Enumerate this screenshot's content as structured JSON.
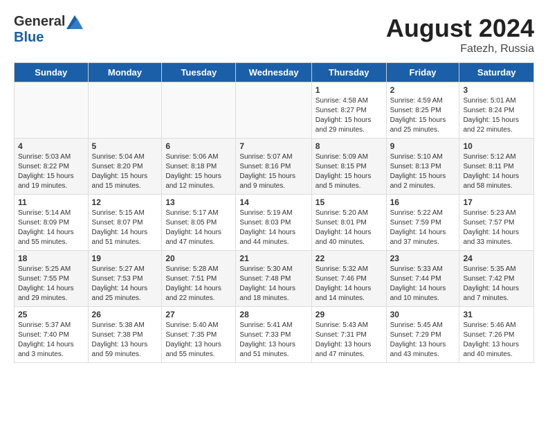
{
  "header": {
    "logo_general": "General",
    "logo_blue": "Blue",
    "month_year": "August 2024",
    "location": "Fatezh, Russia"
  },
  "weekdays": [
    "Sunday",
    "Monday",
    "Tuesday",
    "Wednesday",
    "Thursday",
    "Friday",
    "Saturday"
  ],
  "weeks": [
    [
      {
        "day": "",
        "info": ""
      },
      {
        "day": "",
        "info": ""
      },
      {
        "day": "",
        "info": ""
      },
      {
        "day": "",
        "info": ""
      },
      {
        "day": "1",
        "info": "Sunrise: 4:58 AM\nSunset: 8:27 PM\nDaylight: 15 hours\nand 29 minutes."
      },
      {
        "day": "2",
        "info": "Sunrise: 4:59 AM\nSunset: 8:25 PM\nDaylight: 15 hours\nand 25 minutes."
      },
      {
        "day": "3",
        "info": "Sunrise: 5:01 AM\nSunset: 8:24 PM\nDaylight: 15 hours\nand 22 minutes."
      }
    ],
    [
      {
        "day": "4",
        "info": "Sunrise: 5:03 AM\nSunset: 8:22 PM\nDaylight: 15 hours\nand 19 minutes."
      },
      {
        "day": "5",
        "info": "Sunrise: 5:04 AM\nSunset: 8:20 PM\nDaylight: 15 hours\nand 15 minutes."
      },
      {
        "day": "6",
        "info": "Sunrise: 5:06 AM\nSunset: 8:18 PM\nDaylight: 15 hours\nand 12 minutes."
      },
      {
        "day": "7",
        "info": "Sunrise: 5:07 AM\nSunset: 8:16 PM\nDaylight: 15 hours\nand 9 minutes."
      },
      {
        "day": "8",
        "info": "Sunrise: 5:09 AM\nSunset: 8:15 PM\nDaylight: 15 hours\nand 5 minutes."
      },
      {
        "day": "9",
        "info": "Sunrise: 5:10 AM\nSunset: 8:13 PM\nDaylight: 15 hours\nand 2 minutes."
      },
      {
        "day": "10",
        "info": "Sunrise: 5:12 AM\nSunset: 8:11 PM\nDaylight: 14 hours\nand 58 minutes."
      }
    ],
    [
      {
        "day": "11",
        "info": "Sunrise: 5:14 AM\nSunset: 8:09 PM\nDaylight: 14 hours\nand 55 minutes."
      },
      {
        "day": "12",
        "info": "Sunrise: 5:15 AM\nSunset: 8:07 PM\nDaylight: 14 hours\nand 51 minutes."
      },
      {
        "day": "13",
        "info": "Sunrise: 5:17 AM\nSunset: 8:05 PM\nDaylight: 14 hours\nand 47 minutes."
      },
      {
        "day": "14",
        "info": "Sunrise: 5:19 AM\nSunset: 8:03 PM\nDaylight: 14 hours\nand 44 minutes."
      },
      {
        "day": "15",
        "info": "Sunrise: 5:20 AM\nSunset: 8:01 PM\nDaylight: 14 hours\nand 40 minutes."
      },
      {
        "day": "16",
        "info": "Sunrise: 5:22 AM\nSunset: 7:59 PM\nDaylight: 14 hours\nand 37 minutes."
      },
      {
        "day": "17",
        "info": "Sunrise: 5:23 AM\nSunset: 7:57 PM\nDaylight: 14 hours\nand 33 minutes."
      }
    ],
    [
      {
        "day": "18",
        "info": "Sunrise: 5:25 AM\nSunset: 7:55 PM\nDaylight: 14 hours\nand 29 minutes."
      },
      {
        "day": "19",
        "info": "Sunrise: 5:27 AM\nSunset: 7:53 PM\nDaylight: 14 hours\nand 25 minutes."
      },
      {
        "day": "20",
        "info": "Sunrise: 5:28 AM\nSunset: 7:51 PM\nDaylight: 14 hours\nand 22 minutes."
      },
      {
        "day": "21",
        "info": "Sunrise: 5:30 AM\nSunset: 7:48 PM\nDaylight: 14 hours\nand 18 minutes."
      },
      {
        "day": "22",
        "info": "Sunrise: 5:32 AM\nSunset: 7:46 PM\nDaylight: 14 hours\nand 14 minutes."
      },
      {
        "day": "23",
        "info": "Sunrise: 5:33 AM\nSunset: 7:44 PM\nDaylight: 14 hours\nand 10 minutes."
      },
      {
        "day": "24",
        "info": "Sunrise: 5:35 AM\nSunset: 7:42 PM\nDaylight: 14 hours\nand 7 minutes."
      }
    ],
    [
      {
        "day": "25",
        "info": "Sunrise: 5:37 AM\nSunset: 7:40 PM\nDaylight: 14 hours\nand 3 minutes."
      },
      {
        "day": "26",
        "info": "Sunrise: 5:38 AM\nSunset: 7:38 PM\nDaylight: 13 hours\nand 59 minutes."
      },
      {
        "day": "27",
        "info": "Sunrise: 5:40 AM\nSunset: 7:35 PM\nDaylight: 13 hours\nand 55 minutes."
      },
      {
        "day": "28",
        "info": "Sunrise: 5:41 AM\nSunset: 7:33 PM\nDaylight: 13 hours\nand 51 minutes."
      },
      {
        "day": "29",
        "info": "Sunrise: 5:43 AM\nSunset: 7:31 PM\nDaylight: 13 hours\nand 47 minutes."
      },
      {
        "day": "30",
        "info": "Sunrise: 5:45 AM\nSunset: 7:29 PM\nDaylight: 13 hours\nand 43 minutes."
      },
      {
        "day": "31",
        "info": "Sunrise: 5:46 AM\nSunset: 7:26 PM\nDaylight: 13 hours\nand 40 minutes."
      }
    ]
  ]
}
